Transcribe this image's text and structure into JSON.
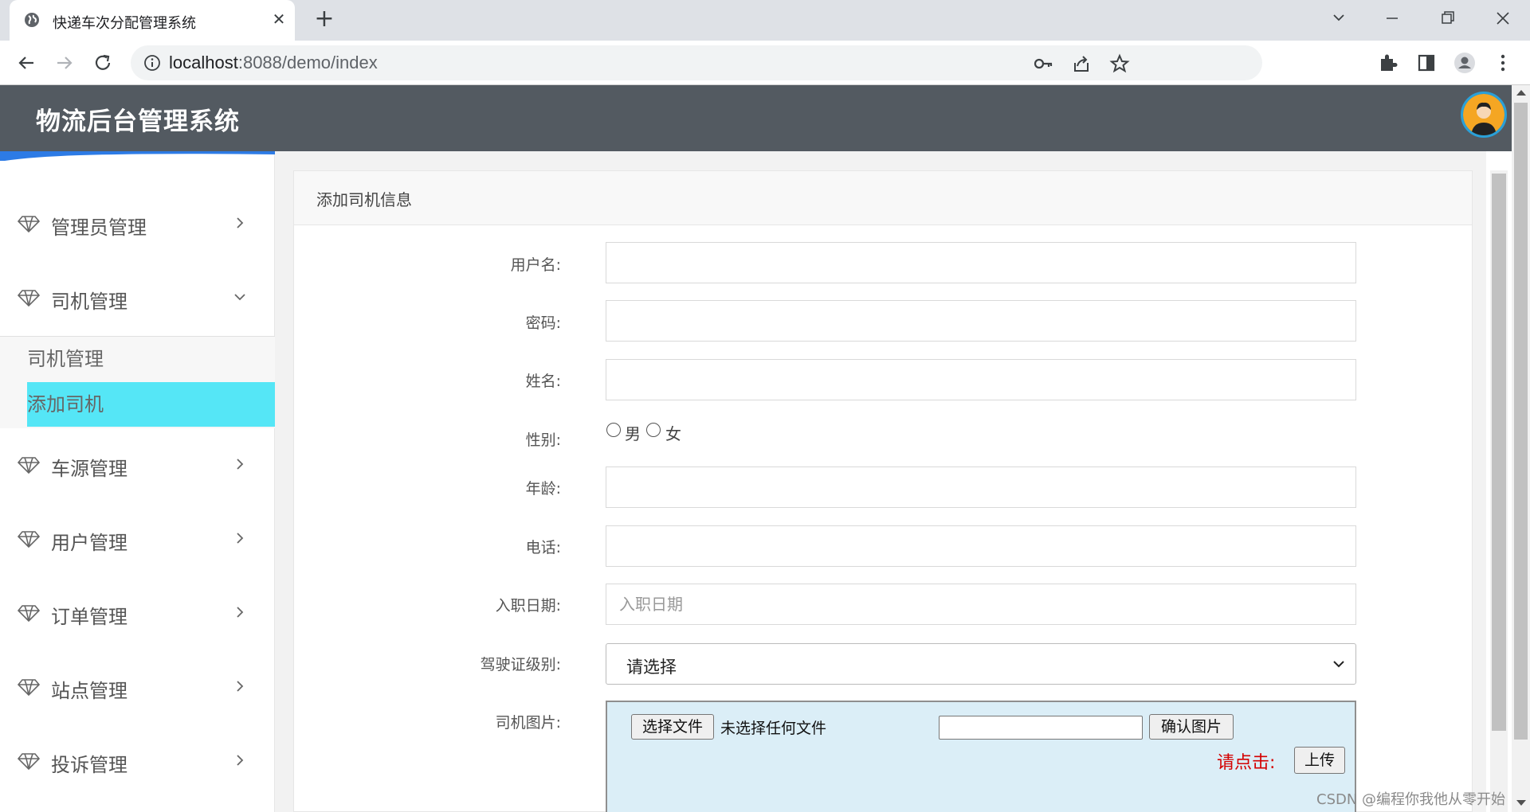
{
  "browser": {
    "tab_title": "快递车次分配管理系统",
    "url_host": "localhost",
    "url_rest": ":8088/demo/index"
  },
  "app": {
    "title": "物流后台管理系统"
  },
  "sidebar": {
    "items": [
      {
        "label": "管理员管理"
      },
      {
        "label": "司机管理"
      },
      {
        "label": "车源管理"
      },
      {
        "label": "用户管理"
      },
      {
        "label": "订单管理"
      },
      {
        "label": "站点管理"
      },
      {
        "label": "投诉管理"
      }
    ],
    "submenu": [
      {
        "label": "司机管理"
      },
      {
        "label": "添加司机"
      }
    ]
  },
  "form": {
    "title": "添加司机信息",
    "labels": {
      "username": "用户名:",
      "password": "密码:",
      "name": "姓名:",
      "gender": "性别:",
      "age": "年龄:",
      "phone": "电话:",
      "hire_date": "入职日期:",
      "license": "驾驶证级别:",
      "photo": "司机图片:"
    },
    "gender_options": [
      "男",
      "女"
    ],
    "hire_date_placeholder": "入职日期",
    "license_selected": "请选择",
    "file_button": "选择文件",
    "file_none": "未选择任何文件",
    "confirm_button": "确认图片",
    "click_label": "请点击:",
    "upload_button": "上传"
  },
  "watermark": "CSDN @编程你我他从零开始",
  "colors": {
    "header_bg": "#535a61",
    "active_sub": "#55e6f6",
    "click_label": "#d40000"
  }
}
